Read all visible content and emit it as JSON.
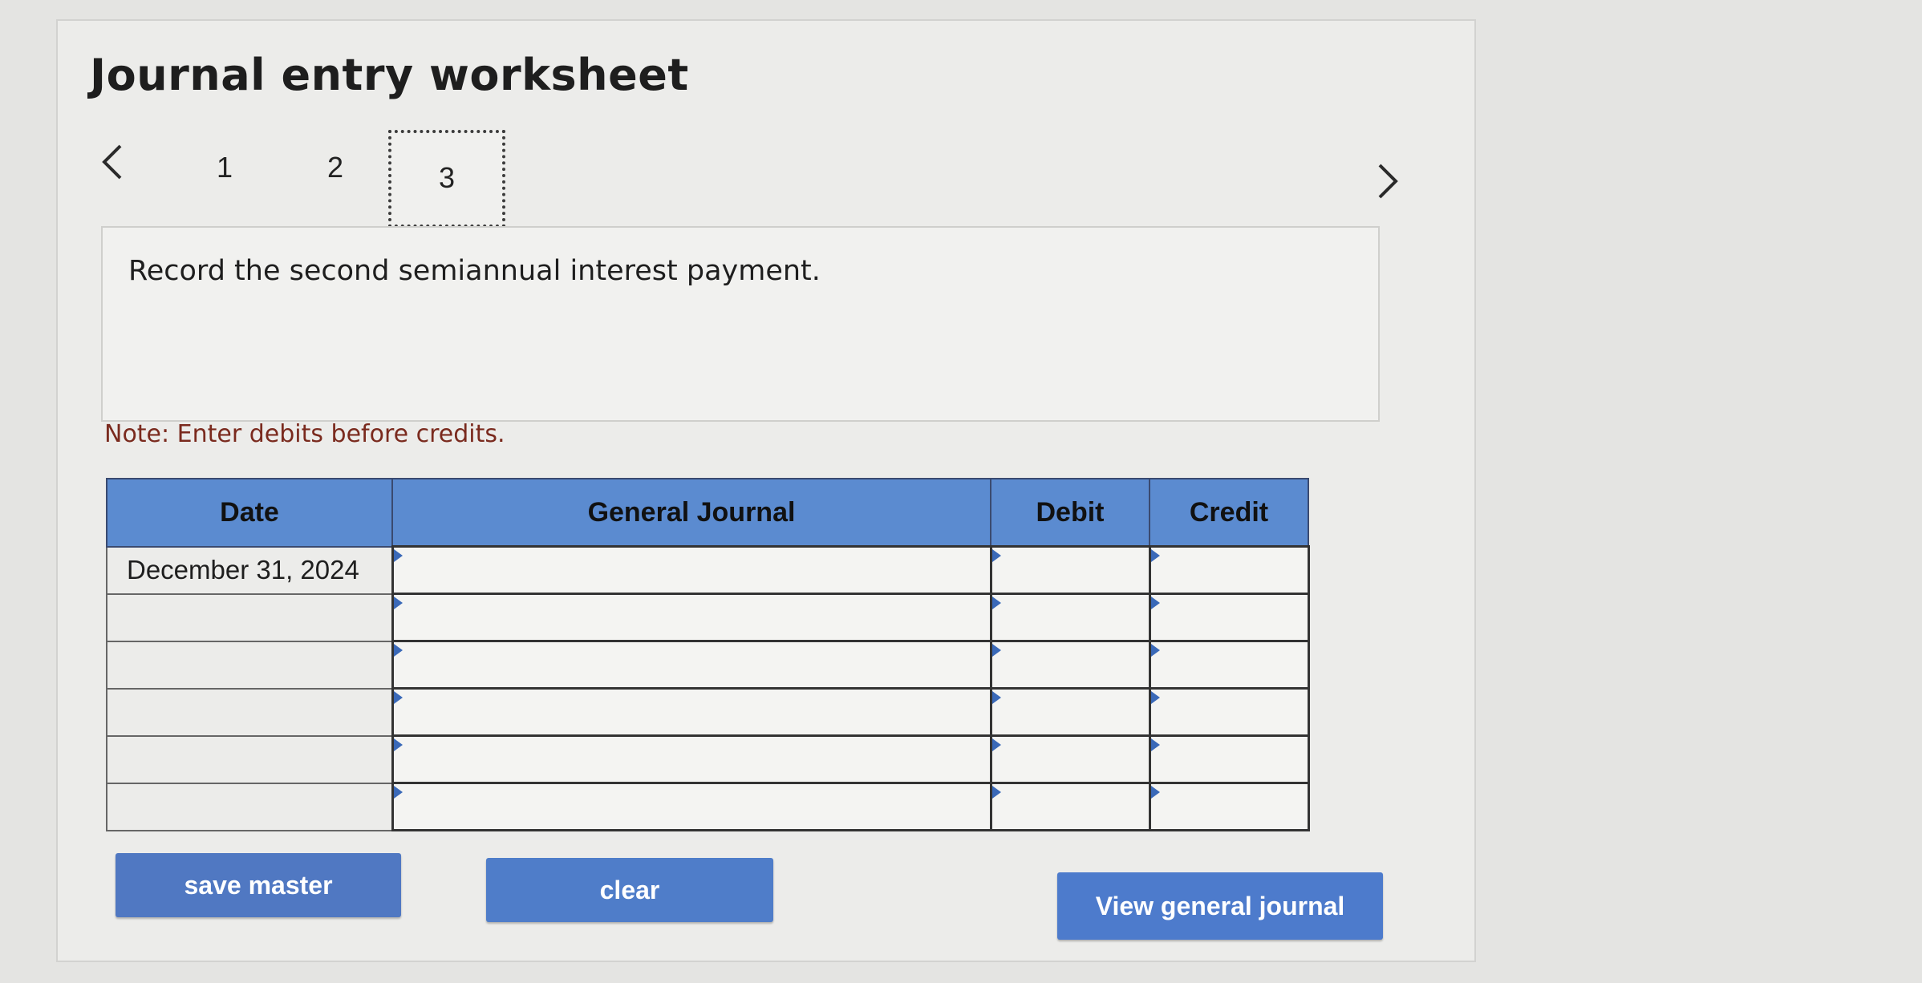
{
  "header": {
    "title": "Journal entry worksheet"
  },
  "steps": {
    "items": [
      "1",
      "2",
      "3"
    ],
    "active": "3"
  },
  "instruction": {
    "text": "Record the second semiannual interest payment."
  },
  "note": {
    "text": "Note: Enter debits before credits."
  },
  "table": {
    "headers": {
      "date": "Date",
      "journal": "General Journal",
      "debit": "Debit",
      "credit": "Credit"
    },
    "rows": [
      {
        "date": "December 31, 2024",
        "account": "",
        "debit": "",
        "credit": ""
      },
      {
        "date": "",
        "account": "",
        "debit": "",
        "credit": ""
      },
      {
        "date": "",
        "account": "",
        "debit": "",
        "credit": ""
      },
      {
        "date": "",
        "account": "",
        "debit": "",
        "credit": ""
      },
      {
        "date": "",
        "account": "",
        "debit": "",
        "credit": ""
      },
      {
        "date": "",
        "account": "",
        "debit": "",
        "credit": ""
      }
    ]
  },
  "buttons": {
    "save": "save master",
    "clear": "clear",
    "view": "View general journal"
  },
  "icons": {
    "prev": "chevron-left-icon",
    "next": "chevron-right-icon"
  },
  "colors": {
    "header_blue": "#5b8bd0",
    "button_blue": "#4e7bc9",
    "note_red": "#7a2a1e"
  }
}
